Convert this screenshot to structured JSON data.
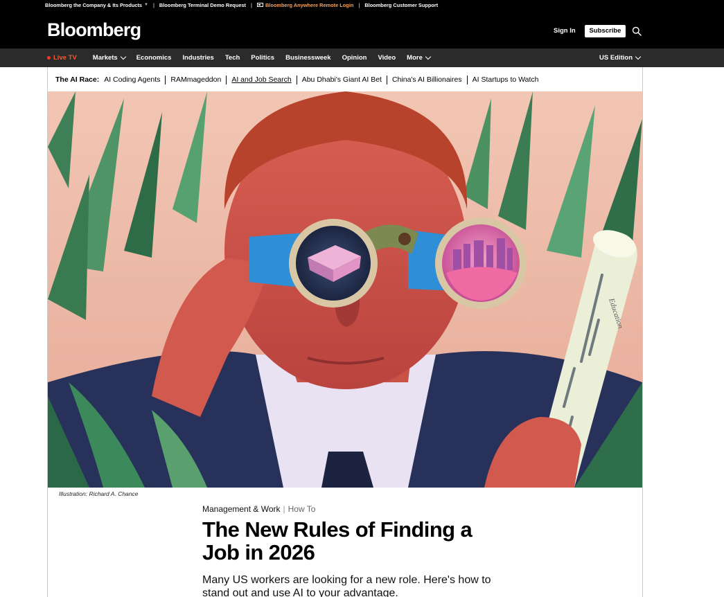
{
  "utility_bar": {
    "company": "Bloomberg the Company & Its Products",
    "terminal_demo": "Bloomberg Terminal Demo Request",
    "anywhere_login": "Bloomberg Anywhere Remote Login",
    "support": "Bloomberg Customer Support"
  },
  "header": {
    "logo": "Bloomberg",
    "sign_in": "Sign In",
    "subscribe": "Subscribe",
    "search_icon": "search-icon"
  },
  "nav": {
    "live_tv": "Live TV",
    "items": [
      "Markets",
      "Economics",
      "Industries",
      "Tech",
      "Politics",
      "Businessweek",
      "Opinion",
      "Video",
      "More"
    ],
    "edition": "US Edition"
  },
  "topic_strip": {
    "lead": "The AI Race:",
    "links": [
      "AI Coding Agents",
      "RAMmageddon",
      "AI and Job Search",
      "Abu Dhabi's Giant AI Bet",
      "China's AI Billionaires",
      "AI Startups to Watch"
    ],
    "active_index": 2
  },
  "hero": {
    "scroll_label": "Education"
  },
  "article": {
    "credit": "Illustration: Richard A. Chance",
    "section": "Management & Work",
    "subsection": "How To",
    "headline": "The New Rules of Finding a Job in 2026",
    "dek": "Many US workers are looking for a new role. Here's how to stand out and use AI to your advantage."
  },
  "colors": {
    "masthead": "#000000",
    "nav_bar": "#2b2b2b",
    "live_tv": "#f25b2e",
    "anywhere_login": "#f7a35c"
  }
}
